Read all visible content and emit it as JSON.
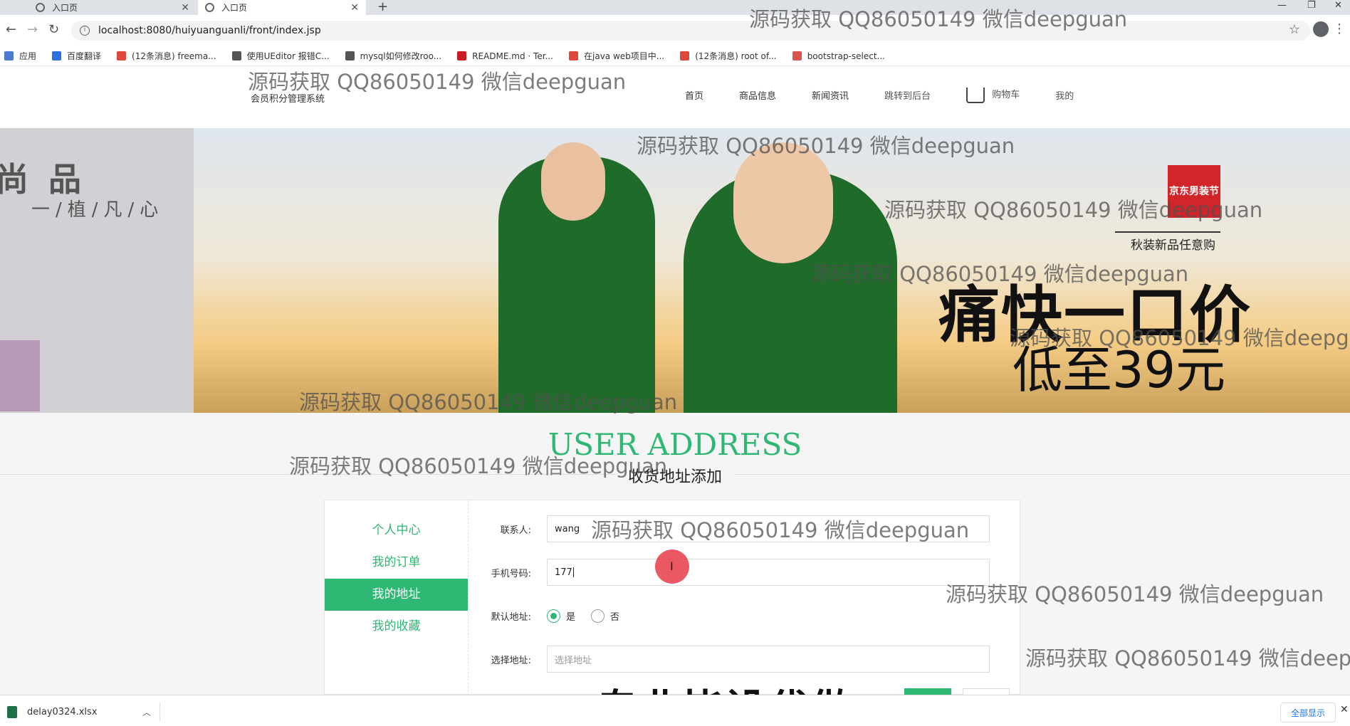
{
  "browser": {
    "tabs": [
      {
        "title": "入口页",
        "active": false
      },
      {
        "title": "入口页",
        "active": true
      }
    ],
    "url": "localhost:8080/huiyuanguanli/front/index.jsp",
    "bookmarks": [
      {
        "label": "应用",
        "icon": "apps-grid-icon",
        "color": "#4a7bd0"
      },
      {
        "label": "百度翻译",
        "icon": "baidu-translate-icon",
        "color": "#2e6fe0"
      },
      {
        "label": "(12条消息) freema...",
        "icon": "csdn-icon",
        "color": "#e0473c"
      },
      {
        "label": "使用UEditor 报错C...",
        "icon": "bird-icon",
        "color": "#555555"
      },
      {
        "label": "mysql如何修改roo...",
        "icon": "bird-icon",
        "color": "#555555"
      },
      {
        "label": "README.md · Ter...",
        "icon": "gitee-icon",
        "color": "#c71d23"
      },
      {
        "label": "在java web项目中...",
        "icon": "csdn-icon",
        "color": "#e0473c"
      },
      {
        "label": "(12条消息) root of...",
        "icon": "csdn-icon",
        "color": "#e0473c"
      },
      {
        "label": "bootstrap-select...",
        "icon": "site-icon",
        "color": "#d9534f"
      }
    ]
  },
  "site": {
    "logo_subtitle": "会员积分管理系统",
    "nav": [
      {
        "label": "首页"
      },
      {
        "label": "商品信息"
      },
      {
        "label": "新闻资讯"
      },
      {
        "label": "跳转到后台"
      },
      {
        "label": "购物车"
      },
      {
        "label": "我的"
      }
    ]
  },
  "banner": {
    "left_title": "尚 品",
    "left_slogan": "一/植/凡/心",
    "brand_badge": "京东男装节",
    "promo_sub": "秋装新品任意购",
    "promo_main": "痛快一口价",
    "promo_price": "低至39元"
  },
  "section": {
    "title": "USER ADDRESS",
    "subtitle": "收货地址添加"
  },
  "side_menu": [
    {
      "label": "个人中心",
      "active": false
    },
    {
      "label": "我的订单",
      "active": false
    },
    {
      "label": "我的地址",
      "active": true
    },
    {
      "label": "我的收藏",
      "active": false
    }
  ],
  "form": {
    "contact_label": "联系人:",
    "contact_value": "wang",
    "phone_label": "手机号码:",
    "phone_value": "177",
    "default_label": "默认地址:",
    "default_yes": "是",
    "default_no": "否",
    "default_selected": "是",
    "address_label": "选择地址:",
    "address_placeholder": "选择地址"
  },
  "watermark": {
    "text": "源码获取 QQ86050149 微信deepguan",
    "big_text": "专业毕设代做"
  },
  "download_bar": {
    "file": "delay0324.xlsx",
    "show_all": "全部显示"
  },
  "colors": {
    "accent": "#2eb873",
    "brand_badge": "#d2252a"
  }
}
